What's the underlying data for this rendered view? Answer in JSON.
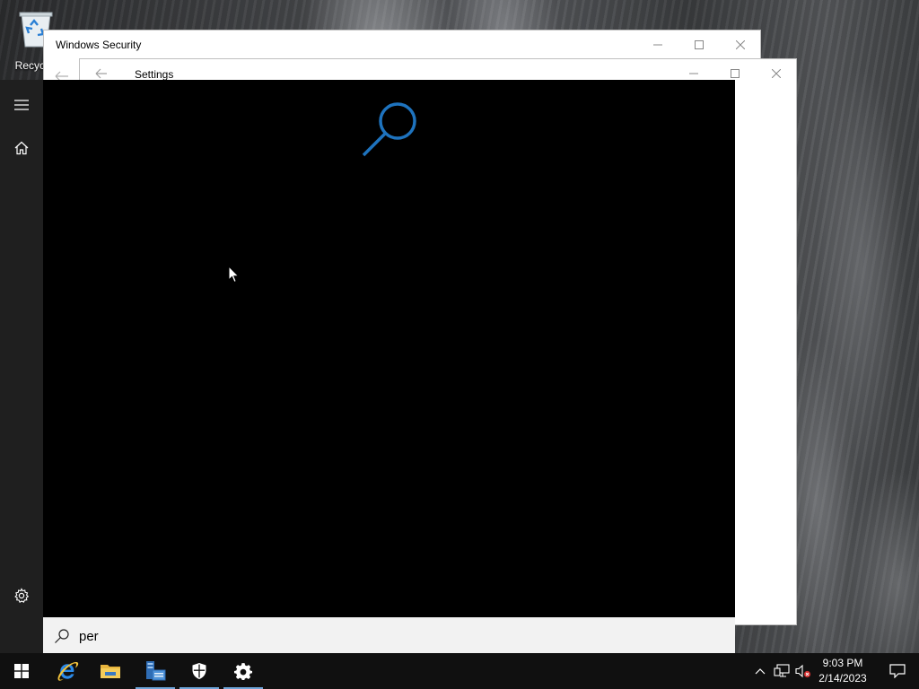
{
  "desktop": {
    "recycle_bin_label": "Recycle"
  },
  "windows": {
    "security": {
      "title": "Windows Security"
    },
    "settings": {
      "title": "Settings"
    }
  },
  "start_search": {
    "query": "per",
    "rail": {
      "menu_icon": "hamburger-icon",
      "home_icon": "home-icon",
      "settings_icon": "gear-icon"
    },
    "accent_color": "#1e73be"
  },
  "taskbar": {
    "pinned": [
      {
        "name": "start",
        "icon": "windows-logo-icon"
      },
      {
        "name": "internet-explorer",
        "icon": "ie-icon"
      },
      {
        "name": "file-explorer",
        "icon": "folder-icon"
      },
      {
        "name": "server-manager",
        "icon": "server-manager-icon"
      },
      {
        "name": "windows-security",
        "icon": "shield-icon"
      },
      {
        "name": "settings",
        "icon": "gear-icon"
      }
    ],
    "clock": {
      "time": "9:03 PM",
      "date": "2/14/2023"
    }
  }
}
